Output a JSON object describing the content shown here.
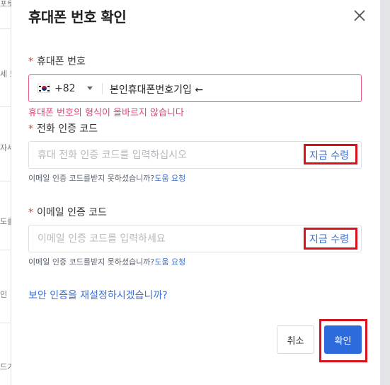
{
  "background": {
    "snippets": [
      "포토",
      "세 모",
      "자세",
      "도를 넣",
      "인",
      "드기"
    ]
  },
  "dialog": {
    "title": "휴대폰 번호 확인",
    "close_icon": "close-icon"
  },
  "phone": {
    "required_mark": "*",
    "label": "휴대폰 번호",
    "country_flag": "south-korea-flag-icon",
    "dial_code": "+82",
    "value": "본인휴대폰번호기입 ←",
    "error": "휴대폰 번호의 형식이 올바르지 않습니다"
  },
  "phone_code": {
    "required_mark": "*",
    "label": "전화 인증 코드",
    "placeholder": "휴대 전화 인증 코드를 입력하십시오",
    "get_code": "지금 수령",
    "hint_text": "이메일 인증 코드를받지 못하셨습니까?",
    "hint_link": "도움 요청"
  },
  "email_code": {
    "required_mark": "*",
    "label": "이메일 인증 코드",
    "placeholder": "이메일 인증 코드를 입력하세요",
    "get_code": "지금 수령",
    "hint_text": "이메일 인증 코드를받지 못하셨습니까?",
    "hint_link": "도움 요청"
  },
  "reset_link": "보안 인증을 재설정하시겠습니까?",
  "buttons": {
    "cancel": "취소",
    "confirm": "확인"
  },
  "colors": {
    "accent": "#2d6bdc",
    "link": "#3a6fd8",
    "error": "#e0457a",
    "required": "#e03c3c",
    "annotation_box": "#d8131b"
  }
}
